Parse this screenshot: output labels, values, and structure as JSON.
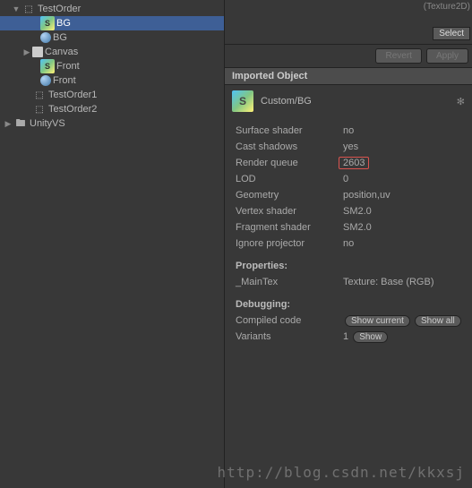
{
  "hierarchy": {
    "items": [
      {
        "indent": 12,
        "expand": "▼",
        "icon": "unity",
        "label": "TestOrder"
      },
      {
        "indent": 33,
        "icon": "s-green",
        "label": "BG",
        "selected": true
      },
      {
        "indent": 33,
        "icon": "sphere",
        "label": "BG"
      },
      {
        "indent": 24,
        "expand": "▶",
        "icon": "canvas",
        "label": "Canvas"
      },
      {
        "indent": 33,
        "icon": "s-green",
        "label": "Front"
      },
      {
        "indent": 33,
        "icon": "sphere",
        "label": "Front"
      },
      {
        "indent": 24,
        "icon": "unity",
        "label": "TestOrder1"
      },
      {
        "indent": 24,
        "icon": "unity",
        "label": "TestOrder2"
      },
      {
        "indent": 3,
        "expand": "▶",
        "icon": "folder",
        "label": "UnityVS"
      }
    ]
  },
  "top": {
    "tex_label": "(Texture2D)",
    "select": "Select"
  },
  "buttons": {
    "revert": "Revert",
    "apply": "Apply"
  },
  "section_title": "Imported Object",
  "shader": {
    "name": "Custom/BG",
    "icon_letter": "S"
  },
  "props": {
    "rows": [
      {
        "label": "Surface shader",
        "value": "no"
      },
      {
        "label": "Cast shadows",
        "value": "yes"
      },
      {
        "label": "Render queue",
        "value": "2603",
        "highlight": true
      },
      {
        "label": "LOD",
        "value": "0"
      },
      {
        "label": "Geometry",
        "value": "position,uv"
      },
      {
        "label": "Vertex shader",
        "value": "SM2.0"
      },
      {
        "label": "Fragment shader",
        "value": "SM2.0"
      },
      {
        "label": "Ignore projector",
        "value": "no"
      }
    ],
    "properties_header": "Properties:",
    "maintex_label": "_MainTex",
    "maintex_value": "Texture: Base (RGB)",
    "debugging_header": "Debugging:",
    "compiled_label": "Compiled code",
    "show_current": "Show current",
    "show_all": "Show all",
    "variants_label": "Variants",
    "variants_value": "1",
    "show": "Show"
  },
  "watermark": "http://blog.csdn.net/kkxsj"
}
